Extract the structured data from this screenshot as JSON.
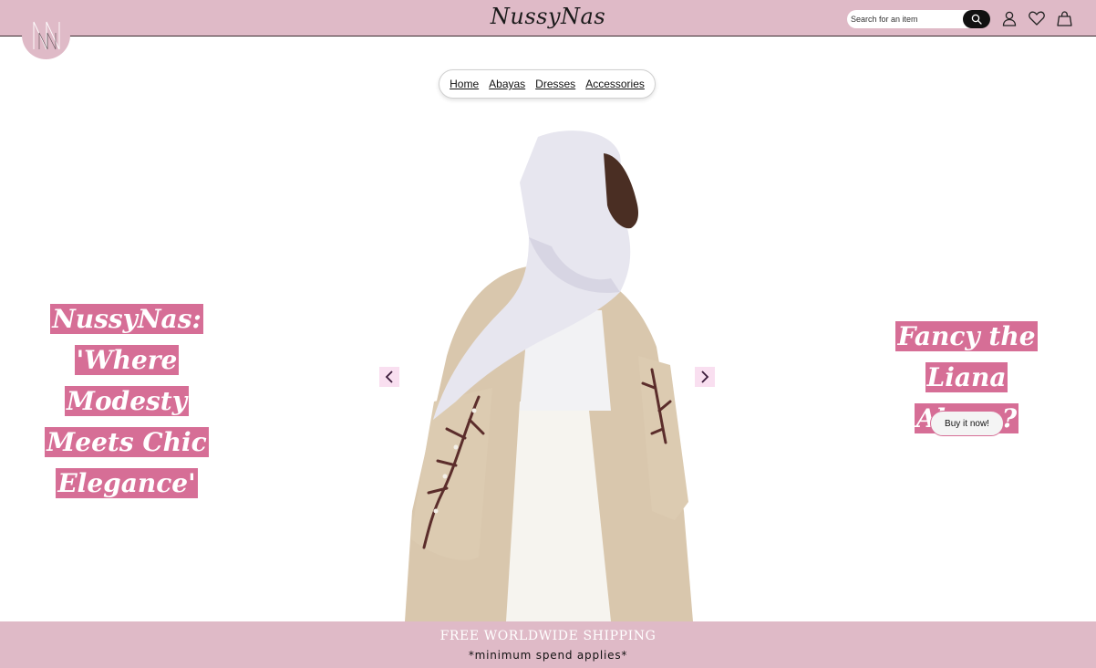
{
  "header": {
    "brand": "NussyNas",
    "search_placeholder": "Search for an item",
    "icons": [
      "search-icon",
      "user-icon",
      "heart-icon",
      "bag-icon"
    ],
    "background": "#dfbac7"
  },
  "nav": {
    "items": [
      {
        "label": "Home"
      },
      {
        "label": "Abayas"
      },
      {
        "label": "Dresses"
      },
      {
        "label": "Accessories"
      }
    ]
  },
  "hero": {
    "tagline_lines": [
      "NussyNas:",
      "'Where Modesty",
      "Meets Chic",
      "Elegance'"
    ],
    "promo_lines": [
      "Fancy the Liana",
      "Abaya?"
    ],
    "buy_button": "Buy it now!",
    "accent": "#d66e96"
  },
  "carousel": {
    "prev_icon": "chevron-left-icon",
    "next_icon": "chevron-right-icon"
  },
  "footer": {
    "shipping": "FREE WORLDWIDE SHIPPING",
    "note": "*minimum spend applies*"
  }
}
